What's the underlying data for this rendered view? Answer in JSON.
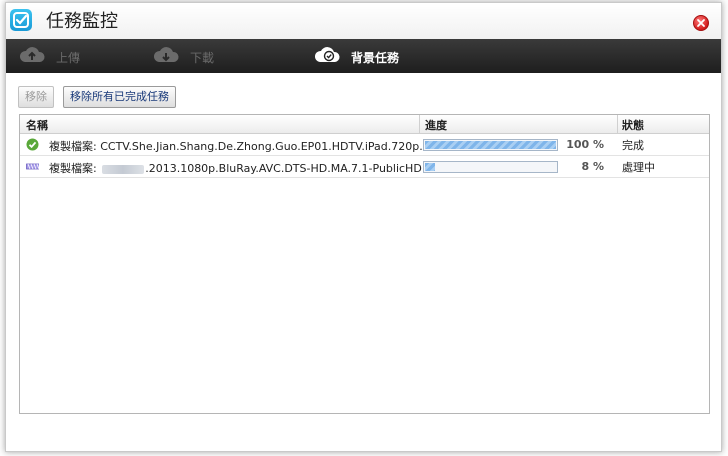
{
  "window": {
    "title": "任務監控"
  },
  "tabs": [
    {
      "label": "上傳",
      "icon": "cloud-upload-icon",
      "active": false
    },
    {
      "label": "下載",
      "icon": "cloud-download-icon",
      "active": false
    },
    {
      "label": "背景任務",
      "icon": "cloud-check-icon",
      "active": true
    }
  ],
  "toolbar": {
    "remove_label": "移除",
    "remove_completed_label": "移除所有已完成任務"
  },
  "table": {
    "columns": [
      "名稱",
      "進度",
      "狀態"
    ],
    "rows": [
      {
        "status_icon": "check-circle-icon",
        "name_prefix": "複製檔案: ",
        "name": "CCTV.She.Jian.Shang.De.Zhong.Guo.EP01.HDTV.iPad.720p.A...",
        "progress": 100,
        "progress_text": "100 %",
        "state": "完成"
      },
      {
        "status_icon": "in-progress-bar-icon",
        "name_prefix": "複製檔案: ",
        "name": ".2013.1080p.BluRay.AVC.DTS-HD.MA.7.1-PublicHD",
        "progress": 8,
        "progress_text": "8 %",
        "state": "處理中"
      }
    ]
  },
  "colors": {
    "tabbar": "#2b2b2b",
    "progress_fill": "#7fb5ea",
    "close": "#d21c1c",
    "success": "#5aa83a"
  }
}
